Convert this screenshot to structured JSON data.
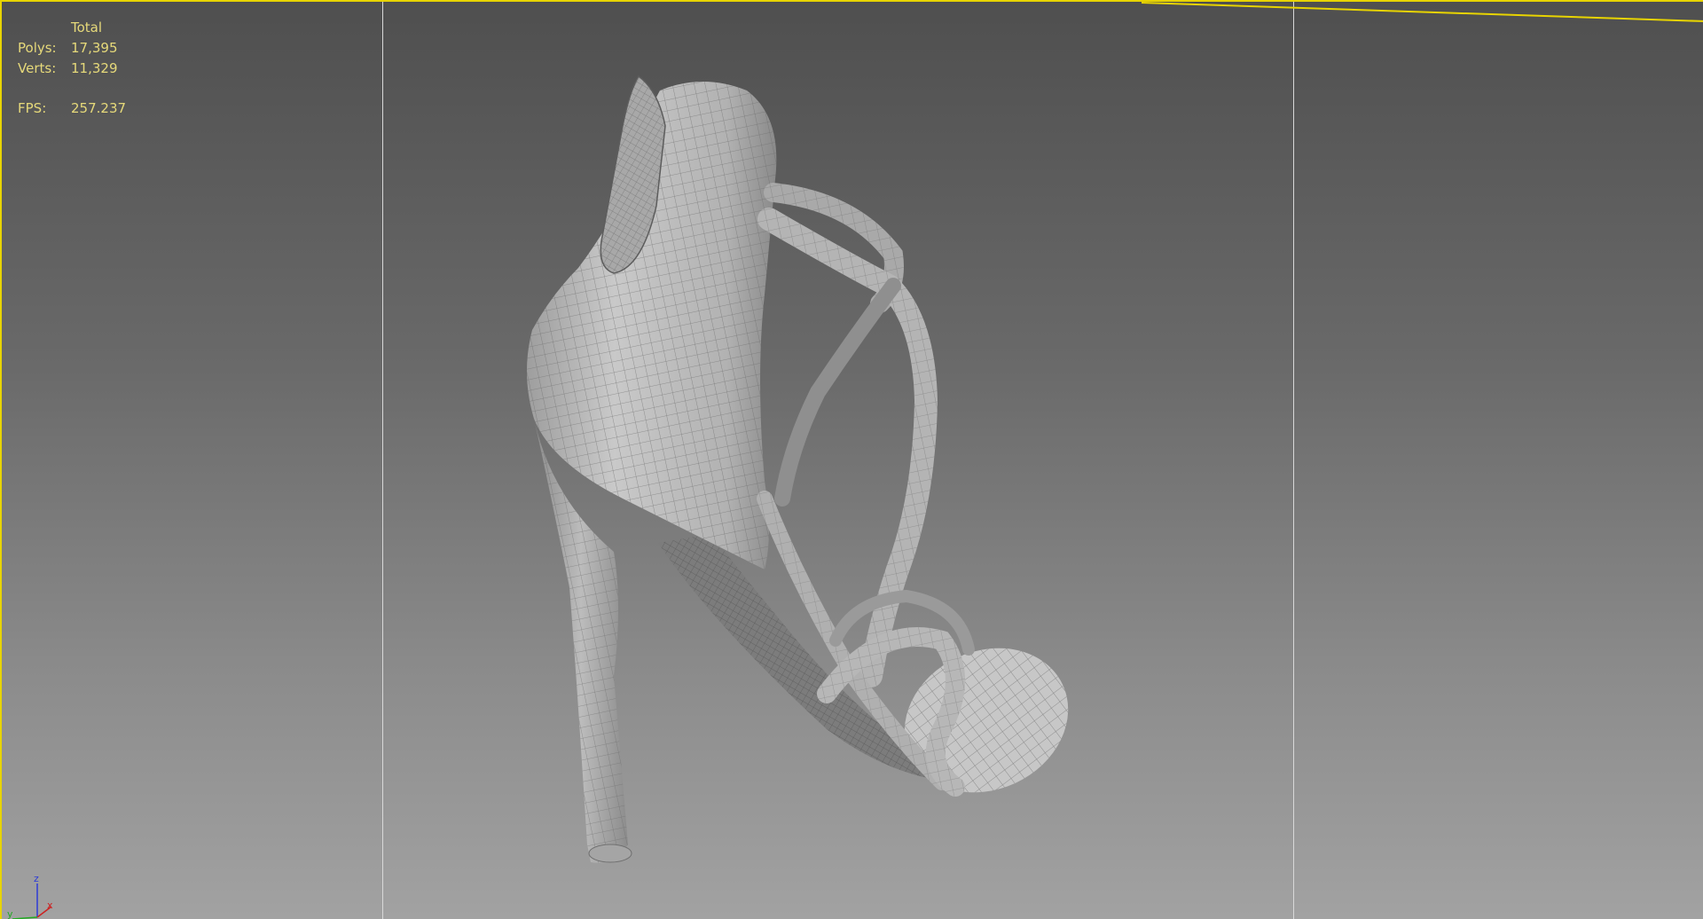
{
  "viewport": {
    "name": "perspective-viewport",
    "colors": {
      "active_border": "#e8d400",
      "stats_text": "#e6d97a",
      "safe_frame": "#d8d8d8",
      "mesh_fill": "#bdbdbd",
      "wire": "#6a6a6a"
    }
  },
  "stats": {
    "header": "Total",
    "polys_label": "Polys:",
    "polys_value": "17,395",
    "verts_label": "Verts:",
    "verts_value": "11,329",
    "fps_label": "FPS:",
    "fps_value": "257.237"
  },
  "axis_gizmo": {
    "z": "z",
    "x": "x",
    "y": "y"
  },
  "scene_object": {
    "icon": "high-heel-sandal-wireframe"
  }
}
